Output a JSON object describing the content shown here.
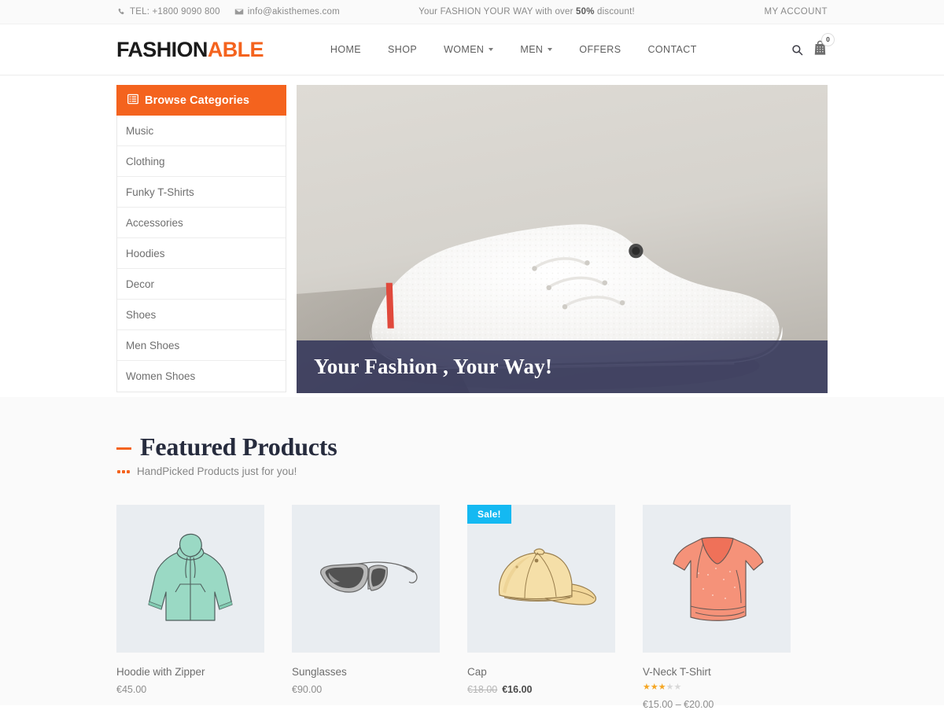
{
  "topbar": {
    "phone_icon": "phone-icon",
    "phone": "TEL: +1800 9090 800",
    "email_icon": "envelope-icon",
    "email": "info@akisthemes.com",
    "promo_pre": "Your FASHION YOUR WAY with over ",
    "promo_strong": "50%",
    "promo_post": " discount!",
    "account": "MY ACCOUNT"
  },
  "header": {
    "logo_first": "FASHION",
    "logo_second": "ABLE",
    "nav": [
      {
        "label": "HOME",
        "caret": false
      },
      {
        "label": "SHOP",
        "caret": false
      },
      {
        "label": "WOMEN",
        "caret": true
      },
      {
        "label": "MEN",
        "caret": true
      },
      {
        "label": "OFFERS",
        "caret": false
      },
      {
        "label": "CONTACT",
        "caret": false
      }
    ],
    "search_icon": "search-icon",
    "cart_icon": "shopping-bag-icon",
    "cart_count": "0"
  },
  "sidebar": {
    "heading": "Browse Categories",
    "heading_icon": "list-icon",
    "items": [
      {
        "label": "Music"
      },
      {
        "label": "Clothing"
      },
      {
        "label": "Funky T-Shirts"
      },
      {
        "label": "Accessories"
      },
      {
        "label": "Hoodies"
      },
      {
        "label": "Decor"
      },
      {
        "label": "Shoes"
      },
      {
        "label": "Men Shoes"
      },
      {
        "label": "Women Shoes"
      }
    ]
  },
  "hero": {
    "caption": "Your Fashion , Your Way!",
    "image_alt": "white-sneaker-photo"
  },
  "featured": {
    "title": "Featured Products",
    "subtitle": "HandPicked Products just for you!",
    "products": [
      {
        "name": "Hoodie with Zipper",
        "price": "€45.00",
        "thumb": "hoodie-illustration",
        "sale": false,
        "rating": null
      },
      {
        "name": "Sunglasses",
        "price": "€90.00",
        "thumb": "sunglasses-illustration",
        "sale": false,
        "rating": null
      },
      {
        "name": "Cap",
        "old_price": "€18.00",
        "price": "€16.00",
        "thumb": "cap-illustration",
        "sale": true,
        "sale_label": "Sale!",
        "rating": null
      },
      {
        "name": "V-Neck T-Shirt",
        "price": "€15.00 – €20.00",
        "thumb": "tshirt-illustration",
        "sale": false,
        "rating": 3,
        "rating_max": 5
      }
    ]
  },
  "colors": {
    "accent": "#f4631e",
    "sale_badge": "#14b9f2",
    "hero_overlay": "#333559",
    "heading": "#262b3d",
    "star": "#f5a623"
  }
}
